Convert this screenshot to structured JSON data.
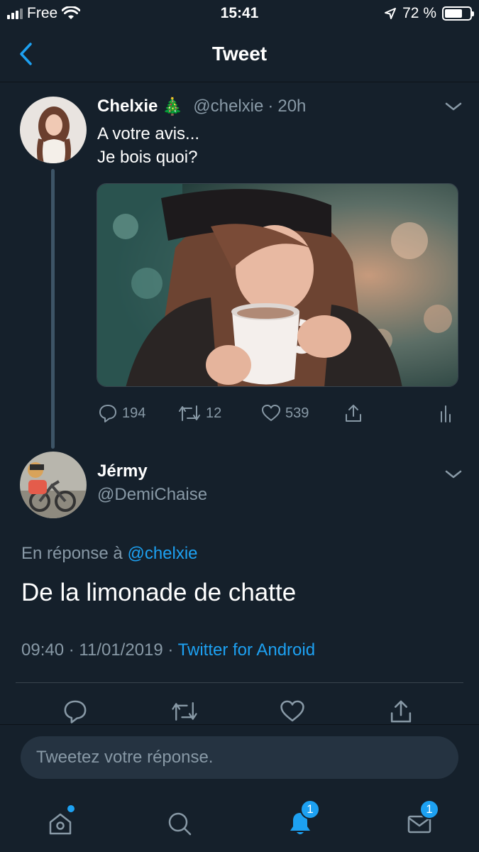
{
  "status_bar": {
    "carrier": "Free",
    "time": "15:41",
    "battery": "72 %",
    "battery_level": 0.72
  },
  "header": {
    "title": "Tweet"
  },
  "parent_tweet": {
    "name": "Chelxie",
    "name_emoji": "🎄",
    "handle": "@chelxie",
    "separator": "·",
    "age": "20h",
    "text_line1": "A votre avis...",
    "text_line2": "Je bois quoi?",
    "replies": "194",
    "retweets": "12",
    "likes": "539"
  },
  "reply": {
    "name": "Jérmy",
    "handle": "@DemiChaise",
    "in_reply_prefix": "En réponse à",
    "in_reply_handle": "@chelxie",
    "text": "De la limonade de chatte",
    "time": "09:40",
    "sep1": "·",
    "date": "11/01/2019",
    "sep2": "·",
    "source": "Twitter for Android"
  },
  "compose": {
    "placeholder": "Tweetez votre réponse."
  },
  "tab_bar": {
    "notifications_badge": "1",
    "messages_badge": "1"
  },
  "colors": {
    "background": "#15202b",
    "accent": "#1da1f2",
    "muted": "#8899a6"
  }
}
